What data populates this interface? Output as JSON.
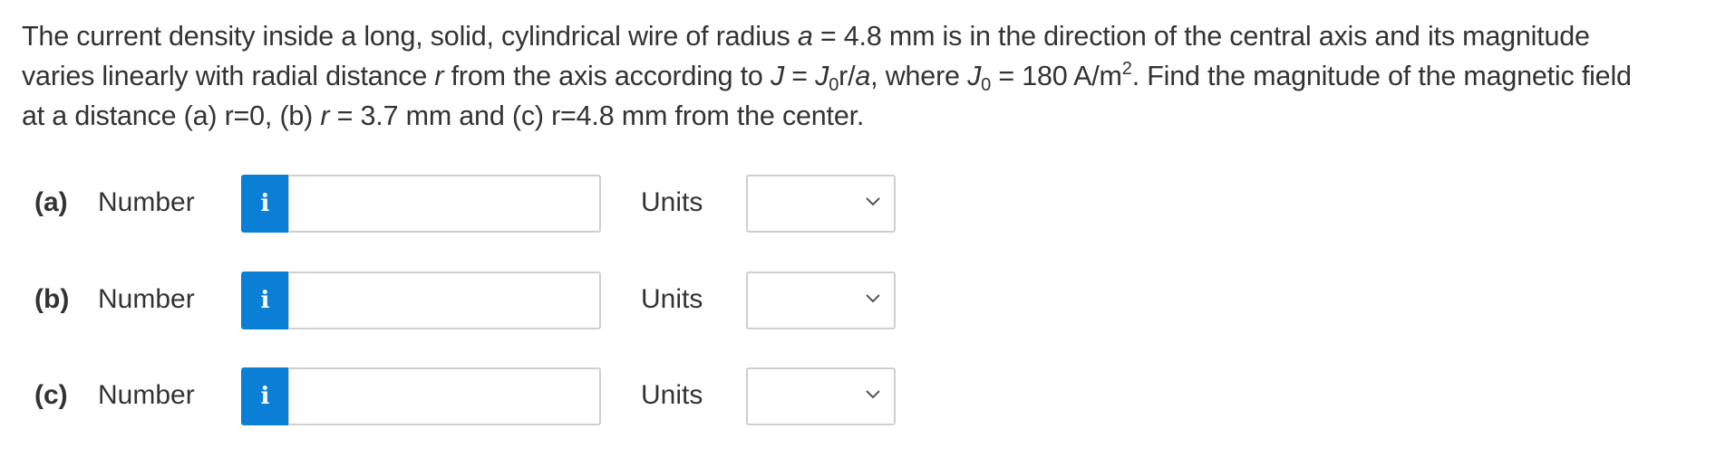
{
  "question": {
    "l1_a": "The current density inside a long, solid, cylindrical wire of radius ",
    "l1_var_a": "a",
    "l1_b": " = 4.8 mm is in the direction of the central axis and its magnitude",
    "l2_a": "varies linearly with radial distance ",
    "l2_var_r": "r",
    "l2_b": " from the axis according to ",
    "l2_var_J": "J",
    "l2_c": " = ",
    "l2_var_J0": "J",
    "l2_sub0": "0",
    "l2_d": "r/",
    "l2_var_a": "a",
    "l2_e": ", where ",
    "l2_var_J0b": "J",
    "l2_sub0b": "0",
    "l2_f": " = 180 A/m",
    "l2_sup2": "2",
    "l2_g": ". Find the magnitude of the magnetic field",
    "l3_a": "at a distance (a) r=0, (b) ",
    "l3_var_r": "r",
    "l3_b": " = 3.7 mm and (c) r=4.8 mm from the center."
  },
  "parts": [
    {
      "label": "(a)",
      "number_label": "Number",
      "info_icon": "i",
      "number_value": "",
      "units_label": "Units",
      "units_value": ""
    },
    {
      "label": "(b)",
      "number_label": "Number",
      "info_icon": "i",
      "number_value": "",
      "units_label": "Units",
      "units_value": ""
    },
    {
      "label": "(c)",
      "number_label": "Number",
      "info_icon": "i",
      "number_value": "",
      "units_label": "Units",
      "units_value": ""
    }
  ],
  "colors": {
    "info_button": "#0b7fd6",
    "text": "#333333",
    "border": "#cfcfcf"
  }
}
